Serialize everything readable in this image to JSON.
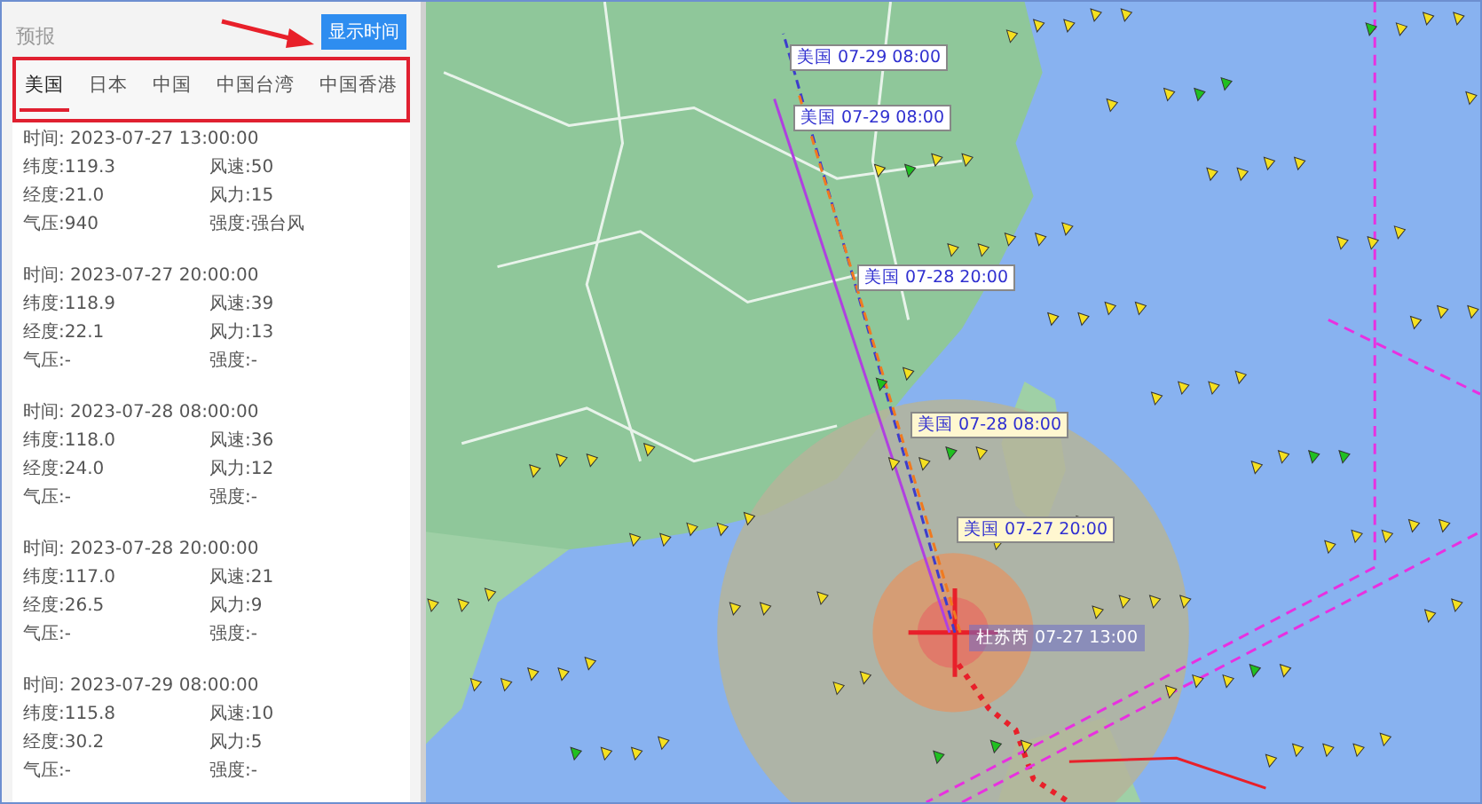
{
  "panel": {
    "title": "预报",
    "button": "显示时间",
    "tabs": [
      {
        "label": "美国",
        "selected": true
      },
      {
        "label": "日本",
        "selected": false
      },
      {
        "label": "中国",
        "selected": false
      },
      {
        "label": "中国台湾",
        "selected": false
      },
      {
        "label": "中国香港",
        "selected": false
      }
    ],
    "entries": [
      {
        "time": "时间: 2023-07-27 13:00:00",
        "fields": [
          "纬度:119.3",
          "风速:50",
          "经度:21.0",
          "风力:15",
          "气压:940",
          "强度:强台风"
        ]
      },
      {
        "time": "时间: 2023-07-27 20:00:00",
        "fields": [
          "纬度:118.9",
          "风速:39",
          "经度:22.1",
          "风力:13",
          "气压:-",
          "强度:-"
        ]
      },
      {
        "time": "时间: 2023-07-28 08:00:00",
        "fields": [
          "纬度:118.0",
          "风速:36",
          "经度:24.0",
          "风力:12",
          "气压:-",
          "强度:-"
        ]
      },
      {
        "time": "时间: 2023-07-28 20:00:00",
        "fields": [
          "纬度:117.0",
          "风速:21",
          "经度:26.5",
          "风力:9",
          "气压:-",
          "强度:-"
        ]
      },
      {
        "time": "时间: 2023-07-29 08:00:00",
        "fields": [
          "纬度:115.8",
          "风速:10",
          "经度:30.2",
          "风力:5",
          "气压:-",
          "强度:-"
        ]
      }
    ]
  },
  "map": {
    "track_labels": [
      {
        "text": "美国 07-29 08:00",
        "kind": "forecast"
      },
      {
        "text": "美国 07-29 08:00",
        "kind": "forecast"
      },
      {
        "text": "美国 07-28 20:00",
        "kind": "forecast"
      },
      {
        "text": "美国 07-28 08:00",
        "kind": "highlight"
      },
      {
        "text": "美国 07-27 20:00",
        "kind": "highlight"
      },
      {
        "text": "杜苏芮 07-27 13:00",
        "kind": "current"
      }
    ]
  }
}
